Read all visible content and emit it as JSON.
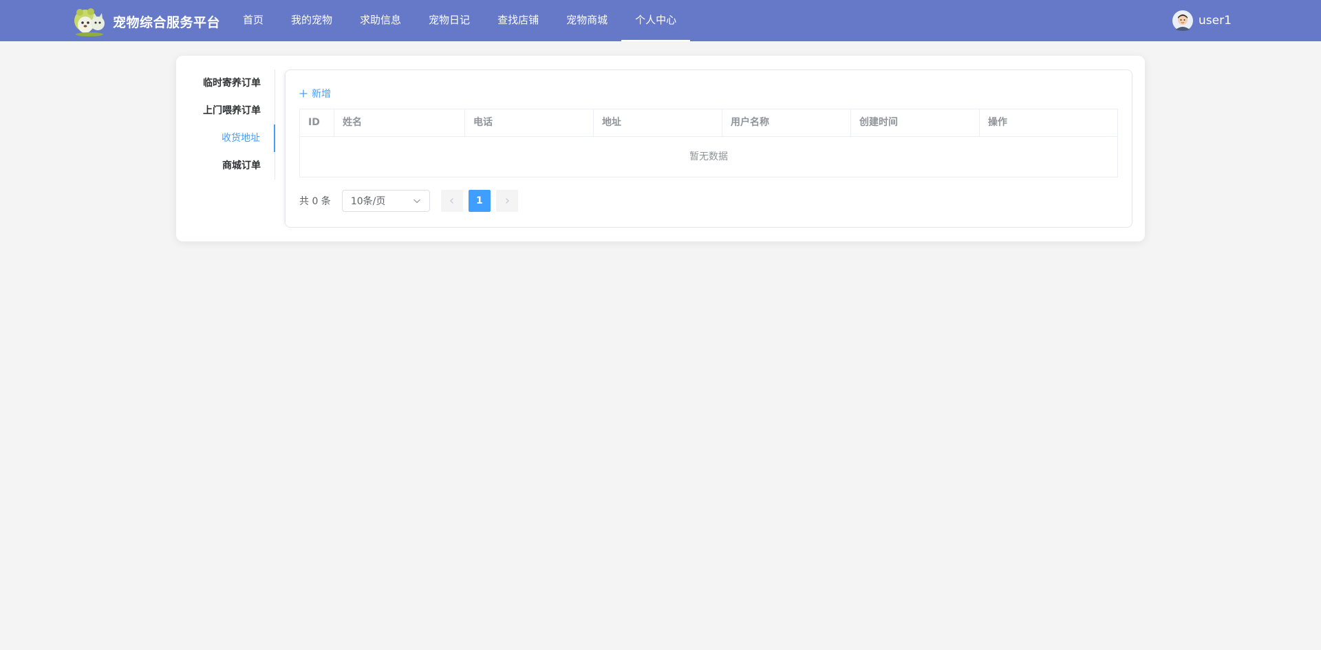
{
  "header": {
    "brand_title": "宠物综合服务平台",
    "nav": [
      {
        "label": "首页",
        "active": false
      },
      {
        "label": "我的宠物",
        "active": false
      },
      {
        "label": "求助信息",
        "active": false
      },
      {
        "label": "宠物日记",
        "active": false
      },
      {
        "label": "查找店铺",
        "active": false
      },
      {
        "label": "宠物商城",
        "active": false
      },
      {
        "label": "个人中心",
        "active": true
      }
    ],
    "username": "user1",
    "bg_color": "#6579c8"
  },
  "sidebar": {
    "items": [
      {
        "label": "临时寄养订单",
        "active": false
      },
      {
        "label": "上门喂养订单",
        "active": false
      },
      {
        "label": "收货地址",
        "active": true
      },
      {
        "label": "商城订单",
        "active": false
      }
    ]
  },
  "toolbar": {
    "add_label": "新增",
    "add_icon": "plus-icon"
  },
  "table": {
    "columns": [
      "ID",
      "姓名",
      "电话",
      "地址",
      "用户名称",
      "创建时间",
      "操作"
    ],
    "rows": [],
    "empty_text": "暂无数据"
  },
  "pagination": {
    "total_text": "共 0 条",
    "page_size": "10条/页",
    "current_page": "1",
    "accent": "#409eff"
  }
}
